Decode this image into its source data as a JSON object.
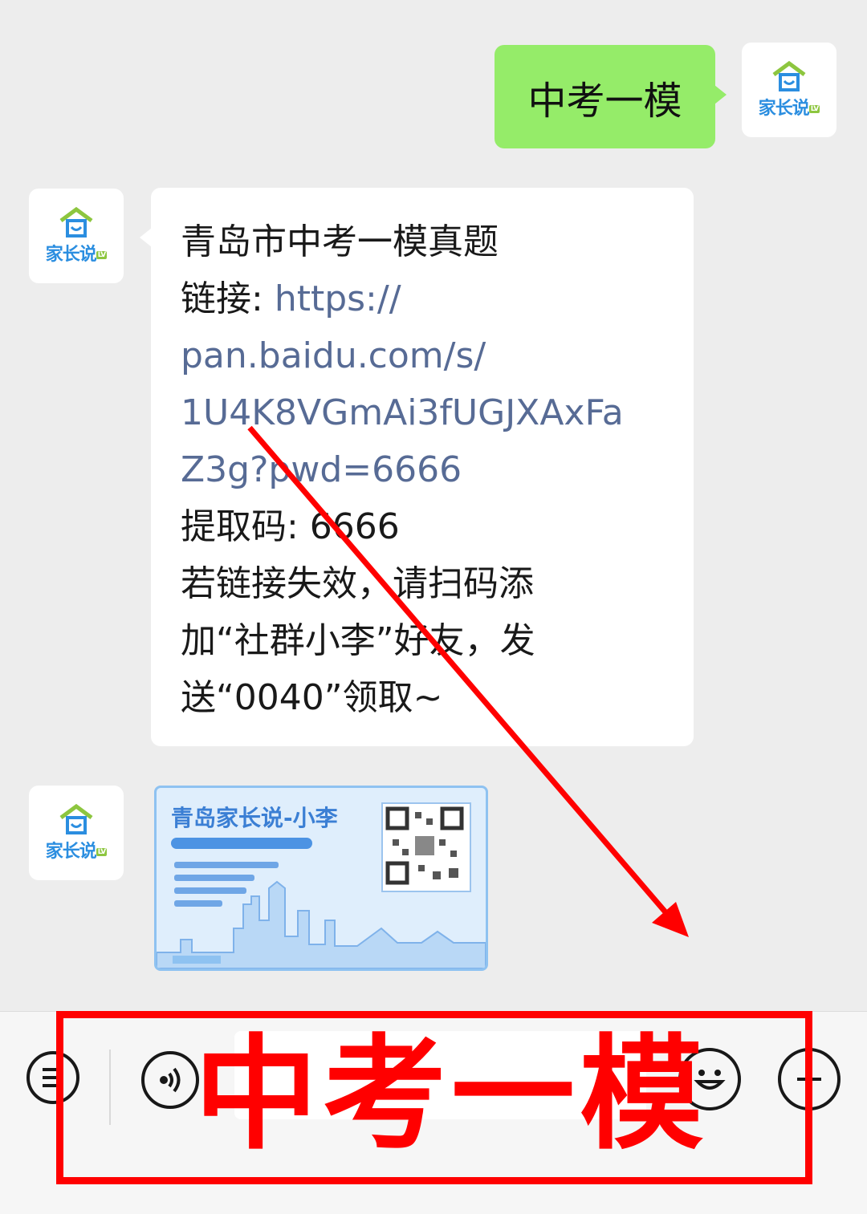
{
  "chat": {
    "outgoing": {
      "text": "中考一模"
    },
    "brand": "家长说",
    "brand_tag": "LV",
    "incoming": {
      "title": "青岛市中考一模真题",
      "link_label": "链接: ",
      "link_lines": [
        "https://",
        "pan.baidu.com/s/",
        "1U4K8VGmAi3fUGJXAxFa",
        "Z3g?pwd=6666"
      ],
      "code_line": "提取码: 6666",
      "note_lines": [
        "若链接失效，请扫码添",
        "加“社群小李”好友，发",
        "送“0040”领取~"
      ]
    },
    "card": {
      "title": "青岛家长说-小李"
    }
  },
  "bottom_bar": {
    "overlay_text": "中考一模"
  },
  "colors": {
    "outgoing_bubble": "#95ec69",
    "link": "#576b95",
    "annotation": "#ff0000",
    "brand": "#2b8ee0"
  },
  "icons": [
    "house-logo-icon",
    "list-icon",
    "voice-icon",
    "emoji-icon",
    "plus-icon",
    "arrow-annotation-icon"
  ]
}
